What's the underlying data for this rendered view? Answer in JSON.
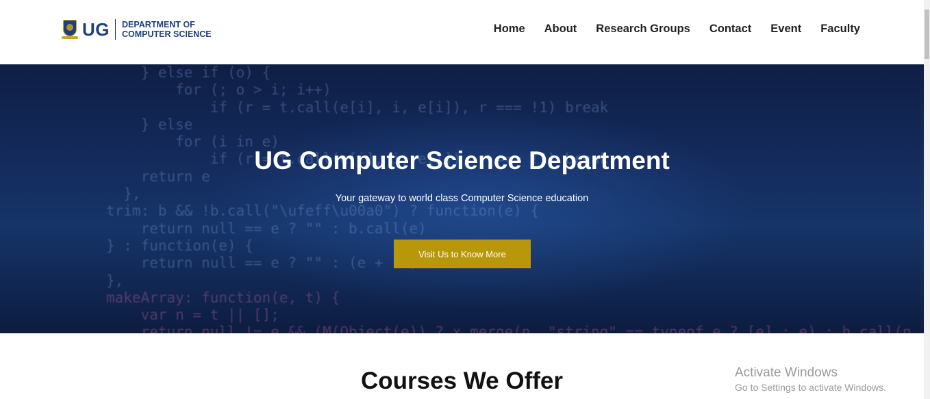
{
  "header": {
    "logo_short": "UG",
    "logo_line1": "DEPARTMENT OF",
    "logo_line2": "COMPUTER SCIENCE",
    "nav": [
      "Home",
      "About",
      "Research Groups",
      "Contact",
      "Event",
      "Faculty"
    ]
  },
  "hero": {
    "code_lines": [
      "    } else if (o) {",
      "        for (; o > i; i++)",
      "            if (r = t.call(e[i], i, e[i]), r === !1) break",
      "    } else",
      "        for (i in e)",
      "            if (r = t.call(e[i], i, e[i]), r === !1) break;",
      "    return e",
      "  },",
      "trim: b && !b.call(\"\\ufeff\\u00a0\") ? function(e) {",
      "    return null == e ? \"\" : b.call(e)",
      "} : function(e) {",
      "    return null == e ? \"\" : (e + \"\")",
      "},",
      "makeArray: function(e, t) {",
      "    var n = t || [];",
      "    return null != e && (M(Object(e)) ? x.merge(n, \"string\" == typeof e ? [e] : e) : h.call(n, e)), n"
    ],
    "title": "UG Computer Science Department",
    "subtitle": "Your gateway to world class Computer Science education",
    "cta_label": "Visit Us to Know More",
    "colors": {
      "button": "#b9970a",
      "overlay": "#152c5e"
    }
  },
  "courses": {
    "title": "Courses We Offer"
  },
  "watermark": {
    "line1": "Activate Windows",
    "line2": "Go to Settings to activate Windows."
  }
}
